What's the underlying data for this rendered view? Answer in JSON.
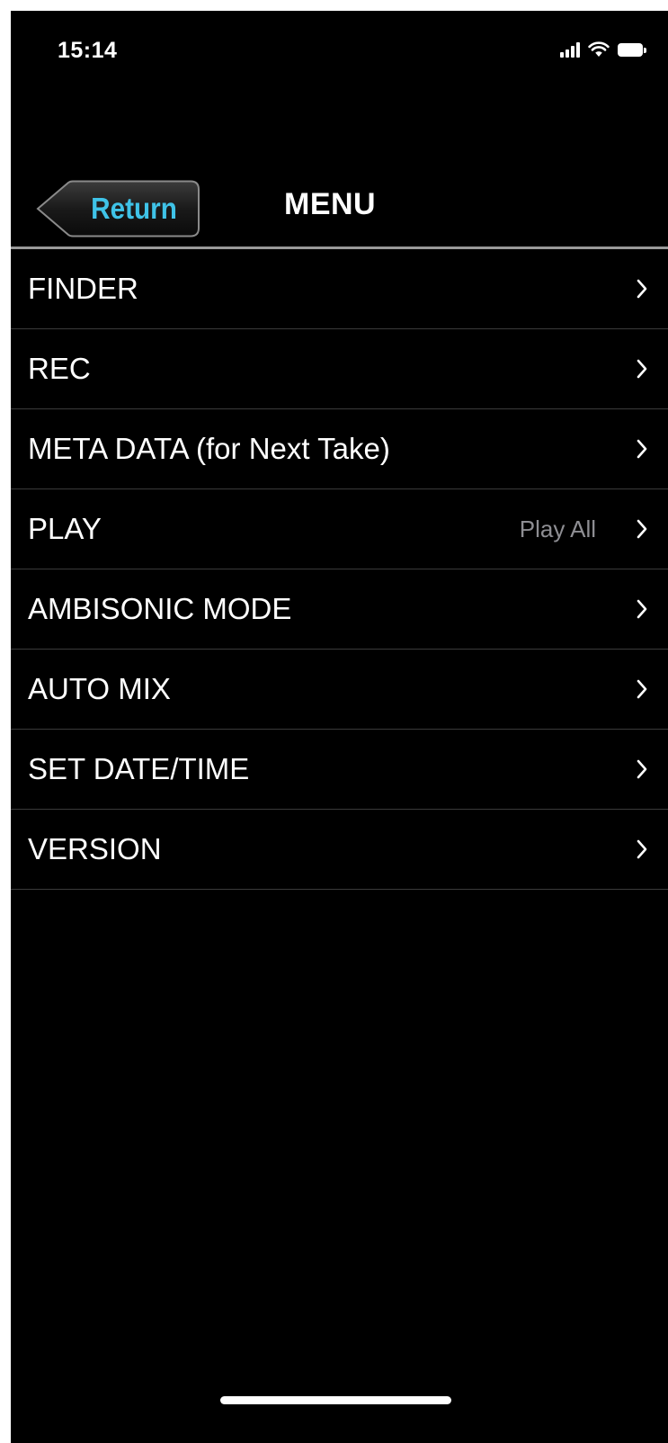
{
  "status_bar": {
    "time": "15:14",
    "icons": [
      "signal-icon",
      "wifi-icon",
      "battery-icon"
    ]
  },
  "nav": {
    "return_label": "Return",
    "title": "MENU"
  },
  "menu": {
    "items": [
      {
        "label": "FINDER",
        "value": ""
      },
      {
        "label": "REC",
        "value": ""
      },
      {
        "label": "META DATA (for Next Take)",
        "value": ""
      },
      {
        "label": "PLAY",
        "value": "Play All"
      },
      {
        "label": "AMBISONIC MODE",
        "value": ""
      },
      {
        "label": "AUTO MIX",
        "value": ""
      },
      {
        "label": "SET DATE/TIME",
        "value": ""
      },
      {
        "label": "VERSION",
        "value": ""
      }
    ]
  },
  "colors": {
    "background": "#000000",
    "text": "#ffffff",
    "accent": "#3fc3e8",
    "secondary_text": "#8e8e93",
    "divider": "#3a3a3a"
  }
}
